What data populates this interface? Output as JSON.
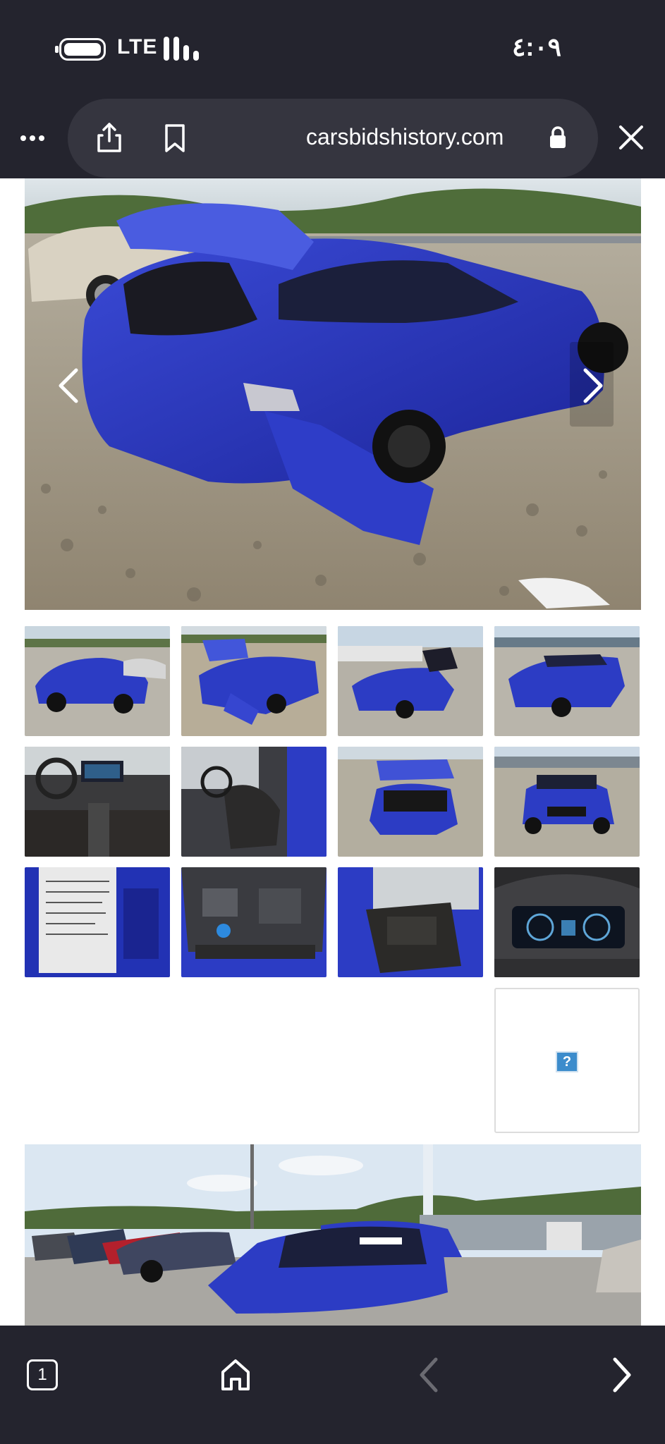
{
  "status_bar": {
    "network": "LTE",
    "time": "٤:٠٩"
  },
  "browser": {
    "url": "carsbidshistory.com",
    "more_icon": "more-dots-icon",
    "share_icon": "share-icon",
    "bookmark_icon": "bookmark-icon",
    "lock_icon": "lock-icon",
    "close_icon": "close-icon"
  },
  "gallery": {
    "prev_icon": "chevron-left-icon",
    "next_icon": "chevron-right-icon",
    "vehicle_color": "#2c3cc4",
    "broken_image_glyph": "?"
  },
  "toolbar": {
    "tab_count": "1",
    "home_icon": "home-icon",
    "back_icon": "back-arrow-icon",
    "forward_icon": "forward-arrow-icon"
  }
}
